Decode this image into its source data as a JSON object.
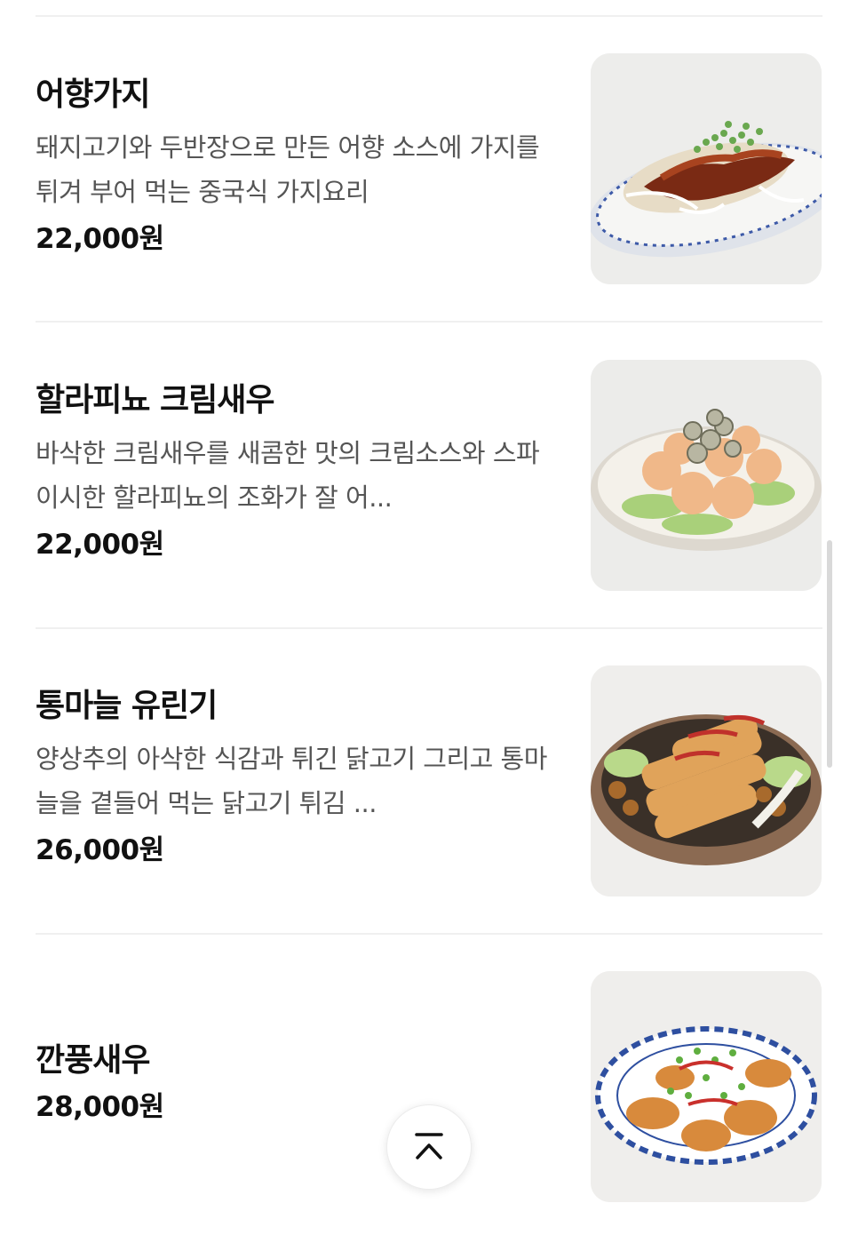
{
  "menu": {
    "items": [
      {
        "name": "어향가지",
        "description": "돼지고기와 두반장으로 만든 어향 소스에 가지를 튀겨 부어 먹는 중국식 가지요리",
        "price": "22,000원",
        "image_icon": "eggplant-dish-photo"
      },
      {
        "name": "할라피뇨 크림새우",
        "description": "바삭한 크림새우를 새콤한 맛의 크림소스와 스파이시한 할라피뇨의 조화가 잘 어...",
        "price": "22,000원",
        "image_icon": "cream-shrimp-dish-photo"
      },
      {
        "name": "통마늘 유린기",
        "description": "양상추의 아삭한 식감과 튀긴 닭고기 그리고 통마늘을 곁들어 먹는 닭고기 튀김 ...",
        "price": "26,000원",
        "image_icon": "fried-chicken-dish-photo"
      },
      {
        "name": "깐풍새우",
        "description": "",
        "price": "28,000원",
        "image_icon": "kkanpung-shrimp-dish-photo"
      }
    ]
  },
  "scroll_top": {
    "icon": "chevron-up-icon"
  },
  "colors": {
    "text": "#111111",
    "description": "#555555",
    "divider": "#f0f0f0"
  }
}
